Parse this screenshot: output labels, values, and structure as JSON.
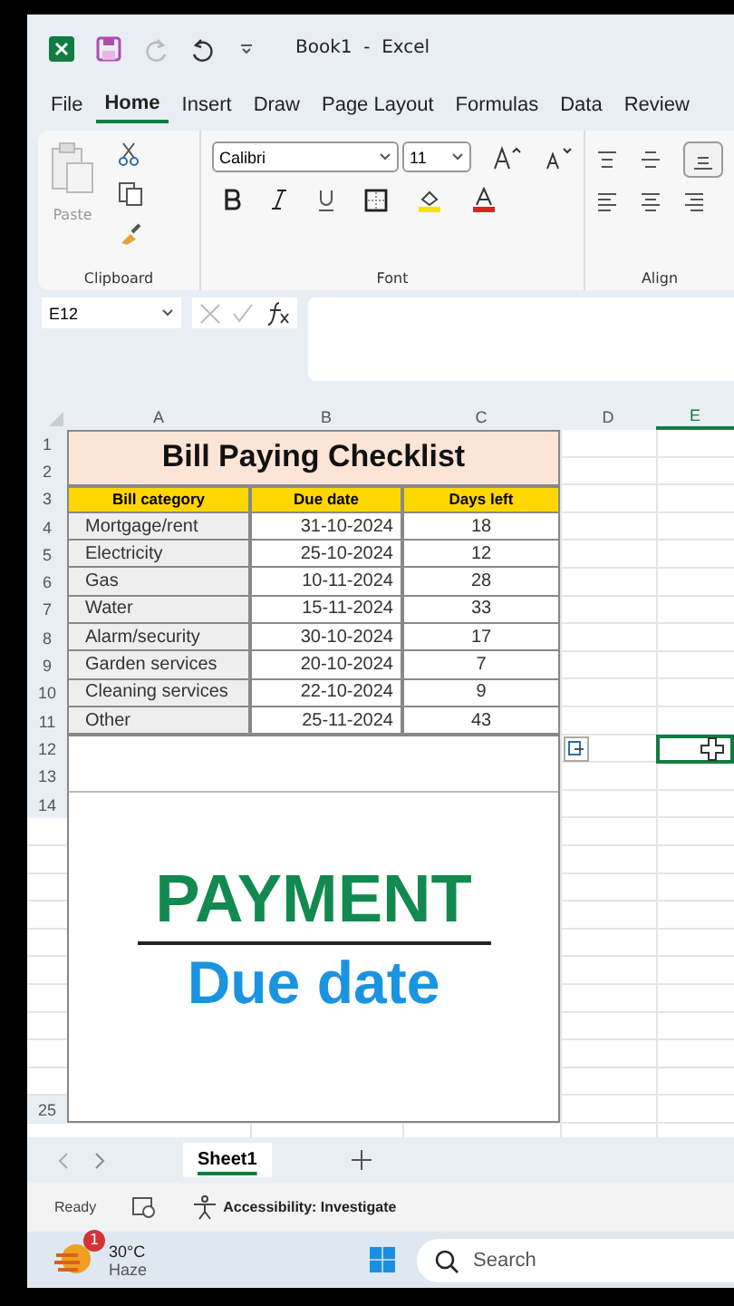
{
  "title_bar": {
    "title": "Book1  -  Excel"
  },
  "menu_tabs": [
    {
      "label": "File",
      "selected": false
    },
    {
      "label": "Home",
      "selected": true
    },
    {
      "label": "Insert",
      "selected": false
    },
    {
      "label": "Draw",
      "selected": false
    },
    {
      "label": "Page Layout",
      "selected": false
    },
    {
      "label": "Formulas",
      "selected": false
    },
    {
      "label": "Data",
      "selected": false
    },
    {
      "label": "Review",
      "selected": false
    }
  ],
  "ribbon": {
    "paste_label": "Paste",
    "font_name": "Calibri",
    "font_size": "11",
    "groups": [
      "Clipboard",
      "Font",
      "Align"
    ]
  },
  "formula_bar": {
    "name_box": "E12"
  },
  "sheet": {
    "columns": [
      {
        "label": "A",
        "selected": false
      },
      {
        "label": "B",
        "selected": false
      },
      {
        "label": "C",
        "selected": false
      },
      {
        "label": "D",
        "selected": false
      },
      {
        "label": "E",
        "selected": true
      }
    ],
    "row_numbers": [
      "1",
      "2",
      "3",
      "4",
      "5",
      "6",
      "7",
      "8",
      "9",
      "10",
      "11",
      "12",
      "13",
      "14",
      "25"
    ],
    "title": "Bill Paying Checklist",
    "headers": [
      "Bill category",
      "Due date",
      "Days left"
    ],
    "rows": [
      [
        "Mortgage/rent",
        "31-10-2024",
        "18"
      ],
      [
        "Electricity",
        "25-10-2024",
        "12"
      ],
      [
        "Gas",
        "10-11-2024",
        "28"
      ],
      [
        "Water",
        "15-11-2024",
        "33"
      ],
      [
        "Alarm/security",
        "30-10-2024",
        "17"
      ],
      [
        "Garden services",
        "20-10-2024",
        "7"
      ],
      [
        "Cleaning services",
        "22-10-2024",
        "9"
      ],
      [
        "Other",
        "25-11-2024",
        "43"
      ]
    ],
    "banner": {
      "line_1": "PAYMENT",
      "line_2": "Due date"
    }
  },
  "sheet_tabs": [
    {
      "label": "Sheet1",
      "selected": true
    }
  ],
  "status_bar": {
    "ready": "Ready",
    "accessibility": "Accessibility: Investigate"
  },
  "taskbar": {
    "weather_badge": "1",
    "temperature": "30°C",
    "condition": "Haze",
    "search_placeholder": "Search"
  }
}
